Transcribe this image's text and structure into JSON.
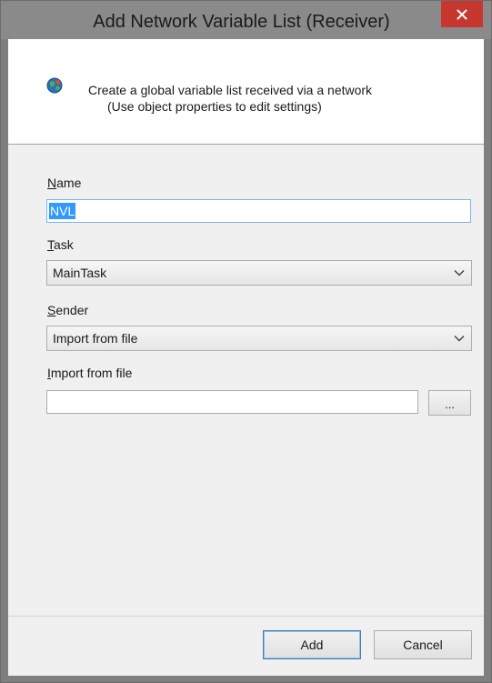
{
  "window": {
    "title": "Add Network Variable List (Receiver)"
  },
  "header": {
    "line1": "Create a global variable list received via a network",
    "line2": "(Use object properties to edit settings)"
  },
  "form": {
    "name": {
      "label_mnemonic": "N",
      "label_rest": "ame",
      "value": "NVL"
    },
    "task": {
      "label_mnemonic": "T",
      "label_rest": "ask",
      "value": "MainTask"
    },
    "sender": {
      "label_mnemonic": "S",
      "label_rest": "ender",
      "value": "Import from file"
    },
    "import_file": {
      "label_mnemonic": "I",
      "label_rest": "mport from file",
      "value": "",
      "browse_label": "..."
    }
  },
  "buttons": {
    "add": "Add",
    "cancel": "Cancel"
  },
  "colors": {
    "close_button": "#c7372f",
    "selection": "#3399ff",
    "client_bg": "#f0f0f0"
  },
  "icons": {
    "header": "network-globe-icon",
    "close": "close-icon",
    "dropdown": "chevron-down-icon"
  }
}
